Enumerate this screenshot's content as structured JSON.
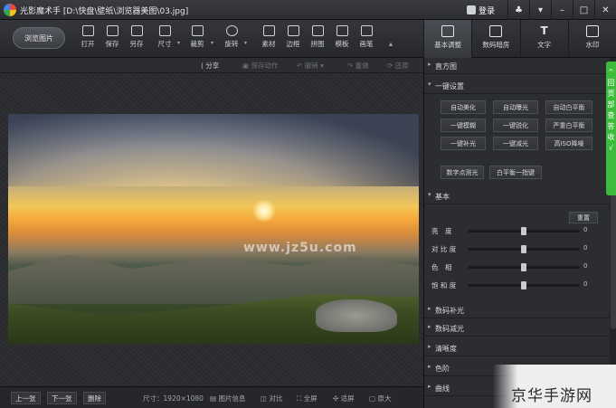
{
  "titlebar": {
    "title": "光影魔术手 [D:\\快盘\\壁纸\\浏览器美图\\03.jpg]",
    "login": "登录",
    "buttons": [
      "♣",
      "▾",
      "–",
      "□",
      "✕"
    ]
  },
  "toolbar": {
    "browse_label": "浏览图片",
    "tools": [
      "打开",
      "保存",
      "另存",
      "尺寸",
      "裁剪",
      "旋转",
      "素材",
      "边框",
      "拼图",
      "模板",
      "画笔"
    ],
    "more": "▴"
  },
  "right_tabs": [
    "基本调整",
    "数码暗房",
    "文字",
    "水印"
  ],
  "subbar": {
    "share": "分享",
    "save_action": "保存动作",
    "undo": "撤销",
    "redo": "重做",
    "restore": "还原"
  },
  "watermark": "www.jz5u.com",
  "bottombar": {
    "prev": "上一张",
    "next": "下一张",
    "delete": "删除",
    "size": "尺寸：1920×1080",
    "info": "图片信息",
    "compare": "对比",
    "fullscreen": "全屏",
    "fit": "适屏",
    "original": "原大"
  },
  "panel": {
    "histogram": "直方图",
    "onekey": "一键设置",
    "onekey_buttons": [
      "自动美化",
      "自动曝光",
      "自动白平衡",
      "一键模糊",
      "一键锐化",
      "严重白平衡",
      "一键补光",
      "一键减光",
      "高ISO降噪",
      "数字点测光",
      "白平衡一指键"
    ],
    "basic": "基本",
    "reset": "重置",
    "sliders": [
      {
        "label": "亮　度",
        "value": "0",
        "level": 0.5
      },
      {
        "label": "对 比 度",
        "value": "0",
        "level": 0.5
      },
      {
        "label": "色　相",
        "value": "0",
        "level": 0.5
      },
      {
        "label": "饱 和 度",
        "value": "0",
        "level": 0.5
      }
    ],
    "sections": [
      "数码补光",
      "数码减光",
      "清晰度",
      "色阶",
      "曲线"
    ]
  },
  "sidefloat": "^回页部查答收√",
  "brand": "京华手游网"
}
